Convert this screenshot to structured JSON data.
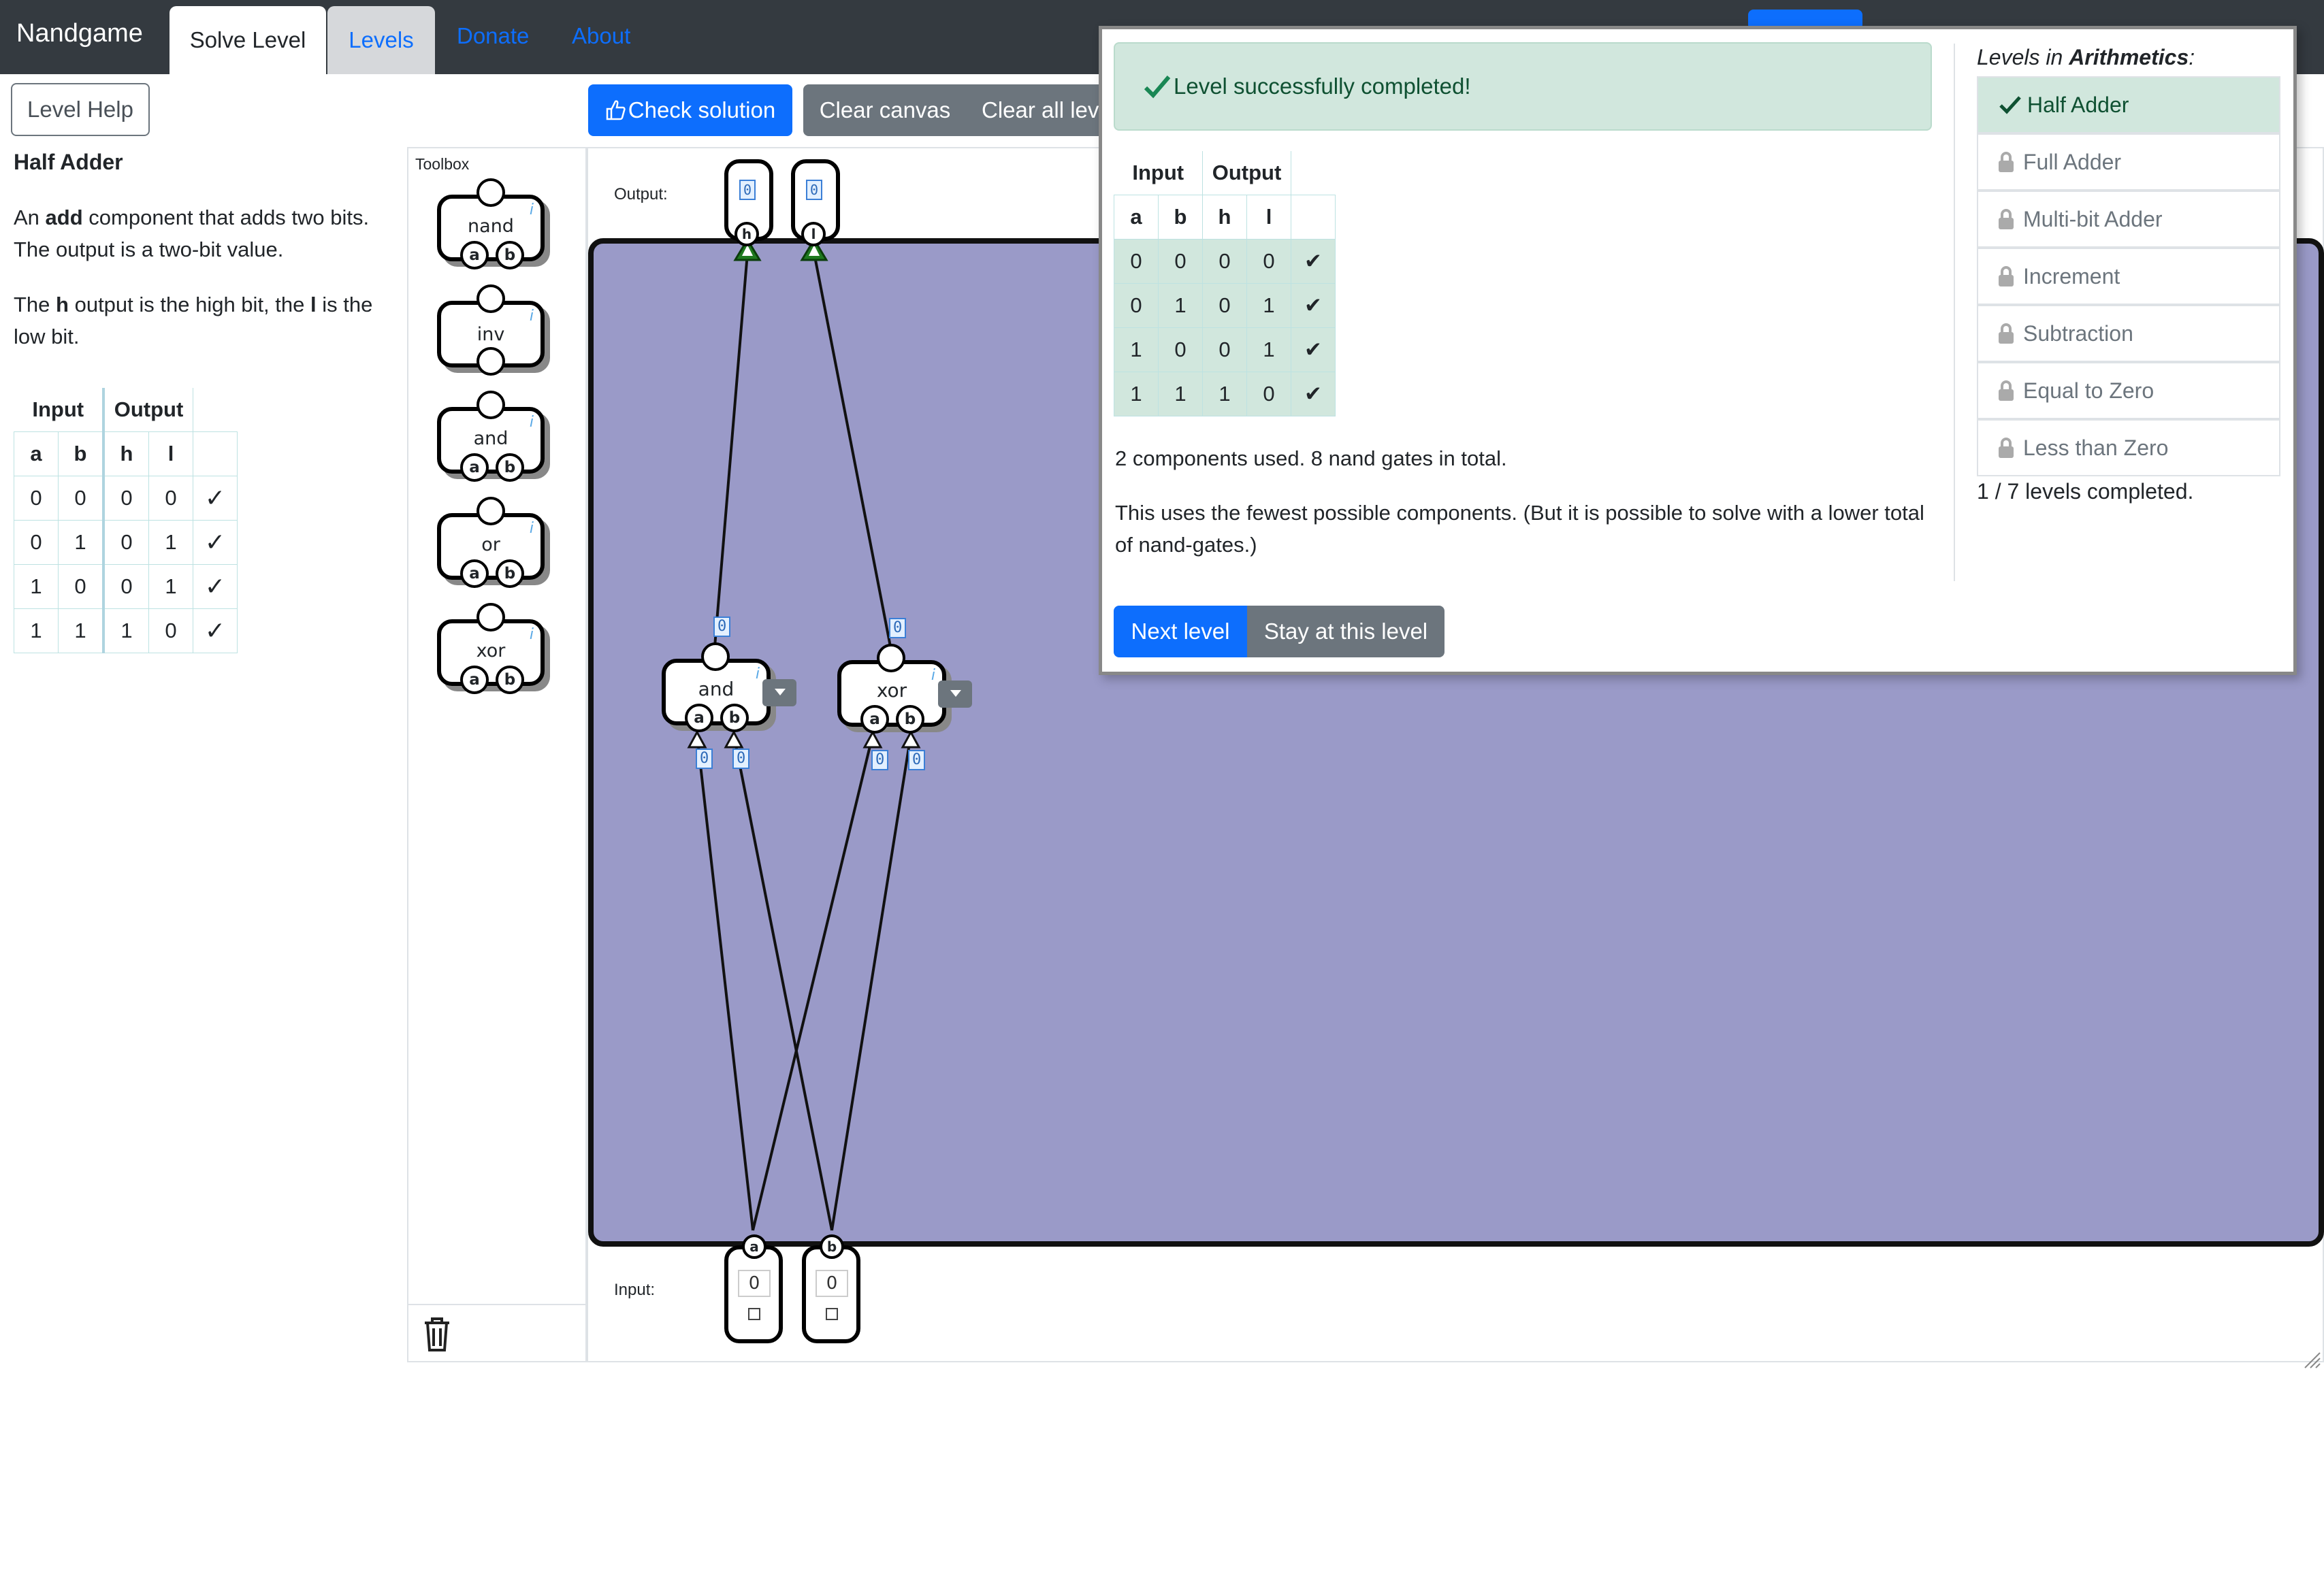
{
  "nav": {
    "brand": "Nandgame",
    "tabs": [
      "Solve Level",
      "Levels"
    ],
    "links": [
      "Donate",
      "About"
    ]
  },
  "toolbar": {
    "level_help": "Level Help",
    "check_solution": "Check solution",
    "clear_canvas": "Clear canvas",
    "clear_all_levels": "Clear all leve"
  },
  "level": {
    "title": "Half Adder",
    "desc_pre": "An ",
    "desc_bold": "add",
    "desc_post": " component that adds two bits. The output is a two-bit value.",
    "desc2_a": "The ",
    "desc2_h": "h",
    "desc2_b": " output is the high bit, the ",
    "desc2_l": "l",
    "desc2_c": " is the low bit."
  },
  "truth_table": {
    "group_headers": [
      "Input",
      "Output"
    ],
    "columns": [
      "a",
      "b",
      "h",
      "l"
    ],
    "rows": [
      [
        "0",
        "0",
        "0",
        "0"
      ],
      [
        "0",
        "1",
        "0",
        "1"
      ],
      [
        "1",
        "0",
        "0",
        "1"
      ],
      [
        "1",
        "1",
        "1",
        "0"
      ]
    ],
    "check_symbol": "✓",
    "popup_check_symbol": "✔"
  },
  "toolbox": {
    "title": "Toolbox",
    "components": [
      "nand",
      "inv",
      "and",
      "or",
      "xor"
    ],
    "pin_a": "a",
    "pin_b": "b",
    "info": "i"
  },
  "canvas": {
    "output_label": "Output:",
    "input_label": "Input:",
    "output_pins": [
      "h",
      "l"
    ],
    "input_pins": [
      "a",
      "b"
    ],
    "output_values": [
      "0",
      "0"
    ],
    "input_values": [
      "0",
      "0"
    ],
    "wire_value": "0",
    "gates": [
      "and",
      "xor"
    ]
  },
  "popup": {
    "success": "Level successfully completed!",
    "stats": "2 components used. 8 nand gates in total.",
    "note": "This uses the fewest possible components. (But it is possible to solve with a lower total of nand-gates.)",
    "next_level": "Next level",
    "stay": "Stay at this level",
    "levels_heading_pre": "Levels in ",
    "levels_heading_bold": "Arithmetics",
    "levels_heading_post": ":",
    "levels": [
      "Half Adder",
      "Full Adder",
      "Multi-bit Adder",
      "Increment",
      "Subtraction",
      "Equal to Zero",
      "Less than Zero"
    ],
    "progress": "1 / 7 levels completed."
  },
  "colors": {
    "navbar": "#343a40",
    "primary": "#0d6efd",
    "secondary": "#6c757d",
    "board": "#9a9ac8",
    "success_bg": "#d1e7dd",
    "success_text": "#0f5132"
  }
}
